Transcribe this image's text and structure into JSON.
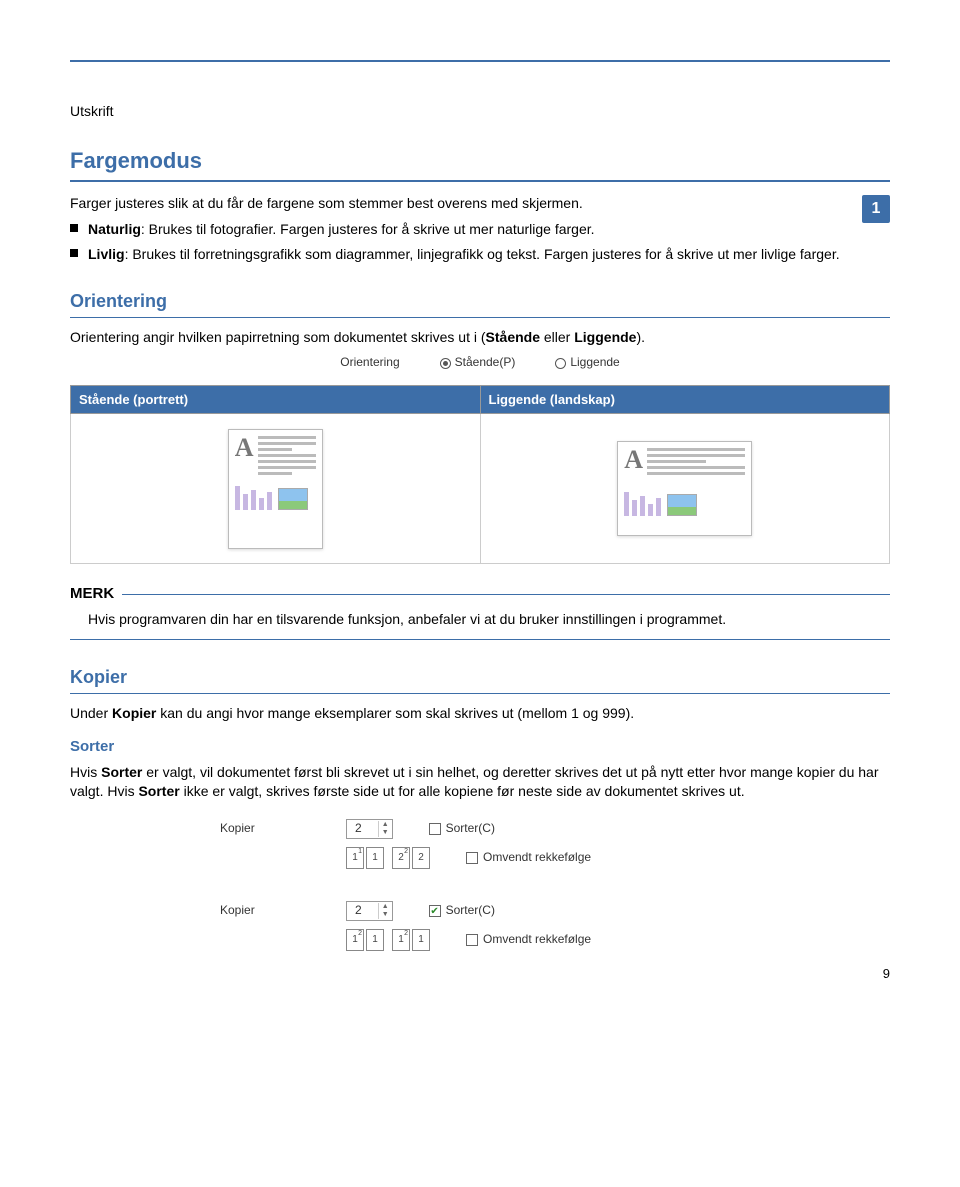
{
  "header_label": "Utskrift",
  "page_badge": "1",
  "fargemodus": {
    "title": "Fargemodus",
    "intro": "Farger justeres slik at du får de fargene som stemmer best overens med skjermen.",
    "item1_bold": "Naturlig",
    "item1_rest": ": Brukes til fotografier. Fargen justeres for å skrive ut mer naturlige farger.",
    "item2_bold": "Livlig",
    "item2_rest": ": Brukes til forretningsgrafikk som diagrammer, linjegrafikk og tekst. Fargen justeres for å skrive ut mer livlige farger."
  },
  "orientering": {
    "title": "Orientering",
    "intro_a": "Orientering angir hvilken papirretning som dokumentet skrives ut i (",
    "intro_b1": "Stående",
    "intro_mid": " eller ",
    "intro_b2": "Liggende",
    "intro_end": ").",
    "radio_label": "Orientering",
    "radio_opt1": "Stående(P)",
    "radio_opt2": "Liggende",
    "th1": "Stående (portrett)",
    "th2": "Liggende (landskap)"
  },
  "merk": {
    "title": "MERK",
    "body": "Hvis programvaren din har en tilsvarende funksjon, anbefaler vi at du bruker innstillingen i programmet."
  },
  "kopier": {
    "title": "Kopier",
    "intro_a": "Under ",
    "intro_b": "Kopier",
    "intro_c": " kan du angi hvor mange eksemplarer som skal skrives ut (mellom 1 og 999).",
    "sorter_title": "Sorter",
    "sorter_a": "Hvis ",
    "sorter_b": "Sorter",
    "sorter_c": " er valgt, vil dokumentet først bli skrevet ut i sin helhet, og deretter skrives det ut på nytt etter hvor mange kopier du har valgt. Hvis ",
    "sorter_d": "Sorter",
    "sorter_e": " ikke er valgt, skrives første side ut for alle kopiene før neste side av dokumentet skrives ut."
  },
  "settings": {
    "kopier_label": "Kopier",
    "kopier_value": "2",
    "sorter_label": "Sorter(C)",
    "reverse_label": "Omvendt rekkefølge"
  },
  "page_number": "9"
}
